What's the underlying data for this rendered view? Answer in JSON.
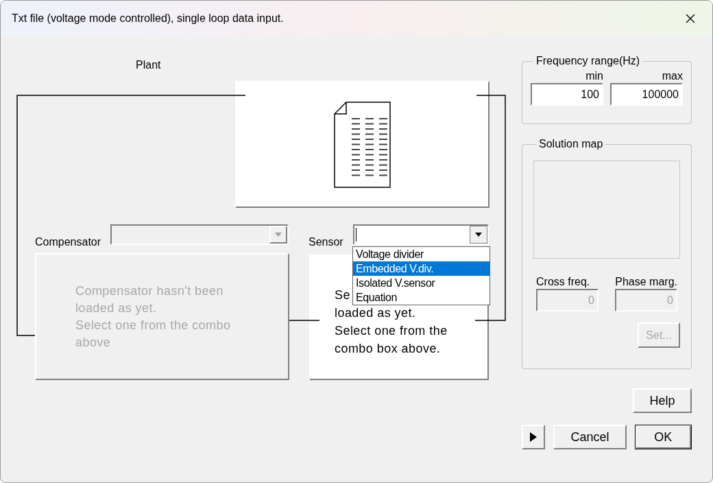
{
  "window": {
    "title": "Txt file (voltage mode controlled), single loop data input."
  },
  "plant": {
    "label": "Plant"
  },
  "compensator": {
    "label": "Compensator",
    "disabled": true,
    "message": [
      "Compensator hasn't been",
      "loaded as yet.",
      "Select one from the combo",
      "above"
    ]
  },
  "sensor": {
    "label": "Sensor",
    "disabled": false,
    "expanded": true,
    "options": [
      {
        "label": "Voltage divider",
        "selected": false
      },
      {
        "label": "Embedded V.div.",
        "selected": true
      },
      {
        "label": "Isolated V.sensor",
        "selected": false
      },
      {
        "label": "Equation",
        "selected": false
      }
    ],
    "message": [
      "Se",
      "loaded as yet.",
      "Select one from the",
      "combo box above."
    ]
  },
  "frequency_range": {
    "title": "Frequency range(Hz)",
    "min": {
      "label": "min",
      "value": "100"
    },
    "max": {
      "label": "max",
      "value": "100000"
    }
  },
  "solution_map": {
    "title": "Solution map",
    "cross_freq": {
      "label": "Cross freq.",
      "value": "0",
      "disabled": true
    },
    "phase_marg": {
      "label": "Phase marg.",
      "value": "0",
      "disabled": true
    },
    "set_button": {
      "label": "Set...",
      "disabled": true
    }
  },
  "buttons": {
    "help": "Help",
    "cancel": "Cancel",
    "ok": "OK"
  }
}
